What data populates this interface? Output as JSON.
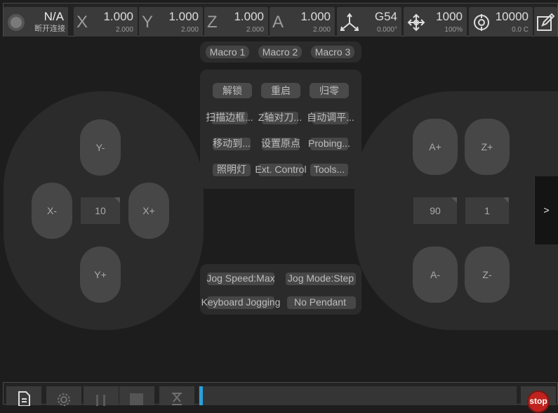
{
  "connection": {
    "title": "N/A",
    "status": "断开连接"
  },
  "axes": [
    {
      "letter": "X",
      "value": "1.000",
      "sub": "2.000"
    },
    {
      "letter": "Y",
      "value": "1.000",
      "sub": "2.000"
    },
    {
      "letter": "Z",
      "value": "1.000",
      "sub": "2.000"
    },
    {
      "letter": "A",
      "value": "1.000",
      "sub": "2.000"
    }
  ],
  "wcs": {
    "value": "G54",
    "sub": "0.000°"
  },
  "feed": {
    "value": "1000",
    "sub": "100%"
  },
  "spindle": {
    "value": "10000",
    "sub": "0.0 C"
  },
  "macros": [
    "Macro 1",
    "Macro 2",
    "Macro 3"
  ],
  "actions": [
    [
      "解锁",
      "重启",
      "归零"
    ],
    [
      "扫描边框...",
      "Z轴对刀...",
      "自动调平..."
    ],
    [
      "移动到...",
      "设置原点",
      "Probing..."
    ],
    [
      "照明灯",
      "Ext. Control",
      "Tools..."
    ]
  ],
  "jog": {
    "y_minus": "Y-",
    "y_plus": "Y+",
    "x_minus": "X-",
    "x_plus": "X+",
    "xy_step": "10",
    "a_plus": "A+",
    "a_minus": "A-",
    "z_plus": "Z+",
    "z_minus": "Z-",
    "a_step": "90",
    "z_step": "1"
  },
  "jog_settings": {
    "speed": "Jog Speed:Max",
    "mode": "Jog Mode:Step",
    "keyboard": "Keyboard Jogging",
    "pendant": "No Pendant"
  },
  "side_toggle": ">",
  "stop_label": "stop"
}
